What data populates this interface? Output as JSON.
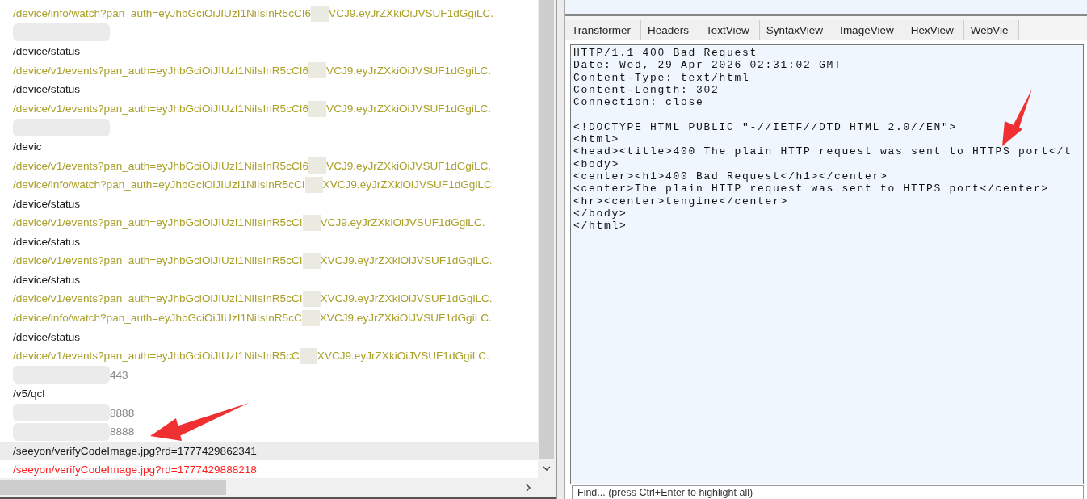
{
  "sessions": [
    {
      "kind": "url",
      "path": "/device/info/watch?pan_auth=eyJhbGciOiJIUzI1NiIsInR5cCI6",
      "tail": "VCJ9.eyJrZXkiOiJVSUF1dGgiLC.",
      "color": "#aaa02a",
      "selected": false
    },
    {
      "kind": "redacted",
      "selected": false
    },
    {
      "kind": "plain",
      "path": "/device/status",
      "color": "#1a1a1a",
      "selected": false
    },
    {
      "kind": "url",
      "path": "/device/v1/events?pan_auth=eyJhbGciOiJIUzI1NiIsInR5cCI6",
      "tail": "VCJ9.eyJrZXkiOiJVSUF1dGgiLC.",
      "color": "#aaa02a",
      "selected": false
    },
    {
      "kind": "plain",
      "path": "/device/status",
      "color": "#1a1a1a",
      "selected": false
    },
    {
      "kind": "url",
      "path": "/device/v1/events?pan_auth=eyJhbGciOiJIUzI1NiIsInR5cCI6",
      "tail": "VCJ9.eyJrZXkiOiJVSUF1dGgiLC.",
      "color": "#aaa02a",
      "selected": false
    },
    {
      "kind": "redacted",
      "selected": false
    },
    {
      "kind": "plain",
      "path": "/devic",
      "color": "#1a1a1a",
      "selected": false
    },
    {
      "kind": "url",
      "path": "/device/v1/events?pan_auth=eyJhbGciOiJIUzI1NiIsInR5cCI6",
      "tail": "VCJ9.eyJrZXkiOiJVSUF1dGgiLC.",
      "color": "#aaa02a",
      "selected": false
    },
    {
      "kind": "url",
      "path": "/device/info/watch?pan_auth=eyJhbGciOiJIUzI1NiIsInR5cCI",
      "tail": "XVCJ9.eyJrZXkiOiJVSUF1dGgiLC.",
      "color": "#aaa02a",
      "selected": false
    },
    {
      "kind": "plain",
      "path": "/device/status",
      "color": "#1a1a1a",
      "selected": false
    },
    {
      "kind": "url",
      "path": "/device/v1/events?pan_auth=eyJhbGciOiJIUzI1NiIsInR5cCI",
      "tail": "VCJ9.eyJrZXkiOiJVSUF1dGgiLC.",
      "color": "#aaa02a",
      "selected": false
    },
    {
      "kind": "plain",
      "path": "/device/status",
      "color": "#1a1a1a",
      "selected": false
    },
    {
      "kind": "url",
      "path": "/device/v1/events?pan_auth=eyJhbGciOiJIUzI1NiIsInR5cCI",
      "tail": "XVCJ9.eyJrZXkiOiJVSUF1dGgiLC.",
      "color": "#aaa02a",
      "selected": false
    },
    {
      "kind": "plain",
      "path": "/device/status",
      "color": "#1a1a1a",
      "selected": false
    },
    {
      "kind": "url",
      "path": "/device/v1/events?pan_auth=eyJhbGciOiJIUzI1NiIsInR5cCI",
      "tail": "XVCJ9.eyJrZXkiOiJVSUF1dGgiLC.",
      "color": "#aaa02a",
      "selected": false
    },
    {
      "kind": "url",
      "path": "/device/info/watch?pan_auth=eyJhbGciOiJIUzI1NiIsInR5cC",
      "tail": "XVCJ9.eyJrZXkiOiJVSUF1dGgiLC.",
      "color": "#aaa02a",
      "selected": false
    },
    {
      "kind": "plain",
      "path": "/device/status",
      "color": "#1a1a1a",
      "selected": false
    },
    {
      "kind": "url",
      "path": "/device/v1/events?pan_auth=eyJhbGciOiJIUzI1NiIsInR5cC",
      "tail": "XVCJ9.eyJrZXkiOiJVSUF1dGgiLC.",
      "color": "#aaa02a",
      "selected": false
    },
    {
      "kind": "redacted",
      "suffix": "443",
      "color": "#888888",
      "selected": false
    },
    {
      "kind": "plain",
      "path": "/v5/qcl",
      "color": "#1a1a1a",
      "selected": false
    },
    {
      "kind": "redacted",
      "suffix": "8888",
      "color": "#888888",
      "selected": false
    },
    {
      "kind": "redacted",
      "suffix": "8888",
      "color": "#888888",
      "selected": false
    },
    {
      "kind": "plain",
      "path": "/seeyon/verifyCodeImage.jpg?rd=1777429862341",
      "color": "#1a1a1a",
      "selected": true
    },
    {
      "kind": "plain",
      "path": "/seeyon/verifyCodeImage.jpg?rd=1777429888218",
      "color": "#ff2020",
      "selected": false
    }
  ],
  "response_tabs": [
    {
      "label": "Transformer",
      "selected": false
    },
    {
      "label": "Headers",
      "selected": false
    },
    {
      "label": "TextView",
      "selected": false
    },
    {
      "label": "SyntaxView",
      "selected": false
    },
    {
      "label": "ImageView",
      "selected": false
    },
    {
      "label": "HexView",
      "selected": false
    },
    {
      "label": "WebVie",
      "selected": false
    }
  ],
  "response_headers": [
    "HTTP/1.1 400 Bad Request",
    "Date: Wed, 29 Apr 2026 02:31:02 GMT",
    "Content-Type: text/html",
    "Content-Length: 302",
    "Connection: close"
  ],
  "response_body": [
    "<!DOCTYPE HTML PUBLIC \"-//IETF//DTD HTML 2.0//EN\">",
    "<html>",
    "<head><title>400 The plain HTTP request was sent to HTTPS port</t",
    "<body>",
    "<center><h1>400 Bad Request</h1></center>",
    "<center>The plain HTTP request was sent to HTTPS port</center>",
    "<hr><center>tengine</center>",
    "</body>",
    "</html>"
  ],
  "find": {
    "placeholder": "Find... (press Ctrl+Enter to highlight all)"
  }
}
